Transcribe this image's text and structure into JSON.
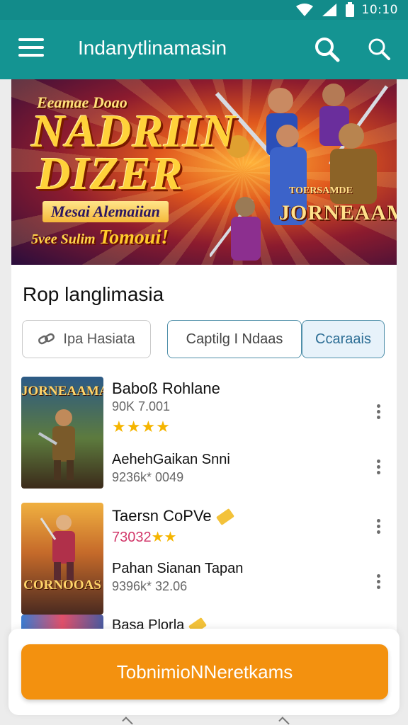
{
  "status_bar": {
    "time": "10:10",
    "colors": {
      "bg": "#128b8a"
    }
  },
  "app_bar": {
    "title": "Indanytlinamasin",
    "menu_icon": "hamburger-menu-icon",
    "action_icons": [
      "search-icon",
      "search-icon"
    ],
    "color": "#149492"
  },
  "banner": {
    "line_small": "Eeamae Doao",
    "line_1": "NADRIIN",
    "line_2": "DIZER",
    "subtitle": "Mesai Alemaiian",
    "tag_prefix": "5vee",
    "tag_mid": "Sulim",
    "tag_big": "Tomoui!",
    "brand_small": "TOERSAMDE",
    "brand": "JORNEAAMA"
  },
  "section": {
    "title": "Rop langlimasia"
  },
  "chips": [
    {
      "label": "Ipa Hasiata",
      "icon": "link-icon"
    },
    {
      "label": "Captilg I Ndaas"
    },
    {
      "label": "Ccaraais",
      "selected": true
    }
  ],
  "items": [
    {
      "name": "Baboß Rohlane",
      "meta": "90K 7.001",
      "stars": "★★★★",
      "sub_name": "AehehGaikan Snni",
      "sub_meta": "9236k* 0049",
      "thumb_top": "JORNEAAMA",
      "thumb_bottom": ""
    },
    {
      "name": "Taersn CoPVe",
      "rating_text": "73032",
      "rating_stars": "★★",
      "sub_name": "Pahan Sianan Tapan",
      "sub_meta": "9396k* 32.06",
      "thumb_top": "",
      "thumb_bottom": "CORNOOAS"
    },
    {
      "name": "Basa Plorla"
    }
  ],
  "cta": {
    "label": "TobnimioNNeretkams",
    "color": "#f3910f"
  }
}
